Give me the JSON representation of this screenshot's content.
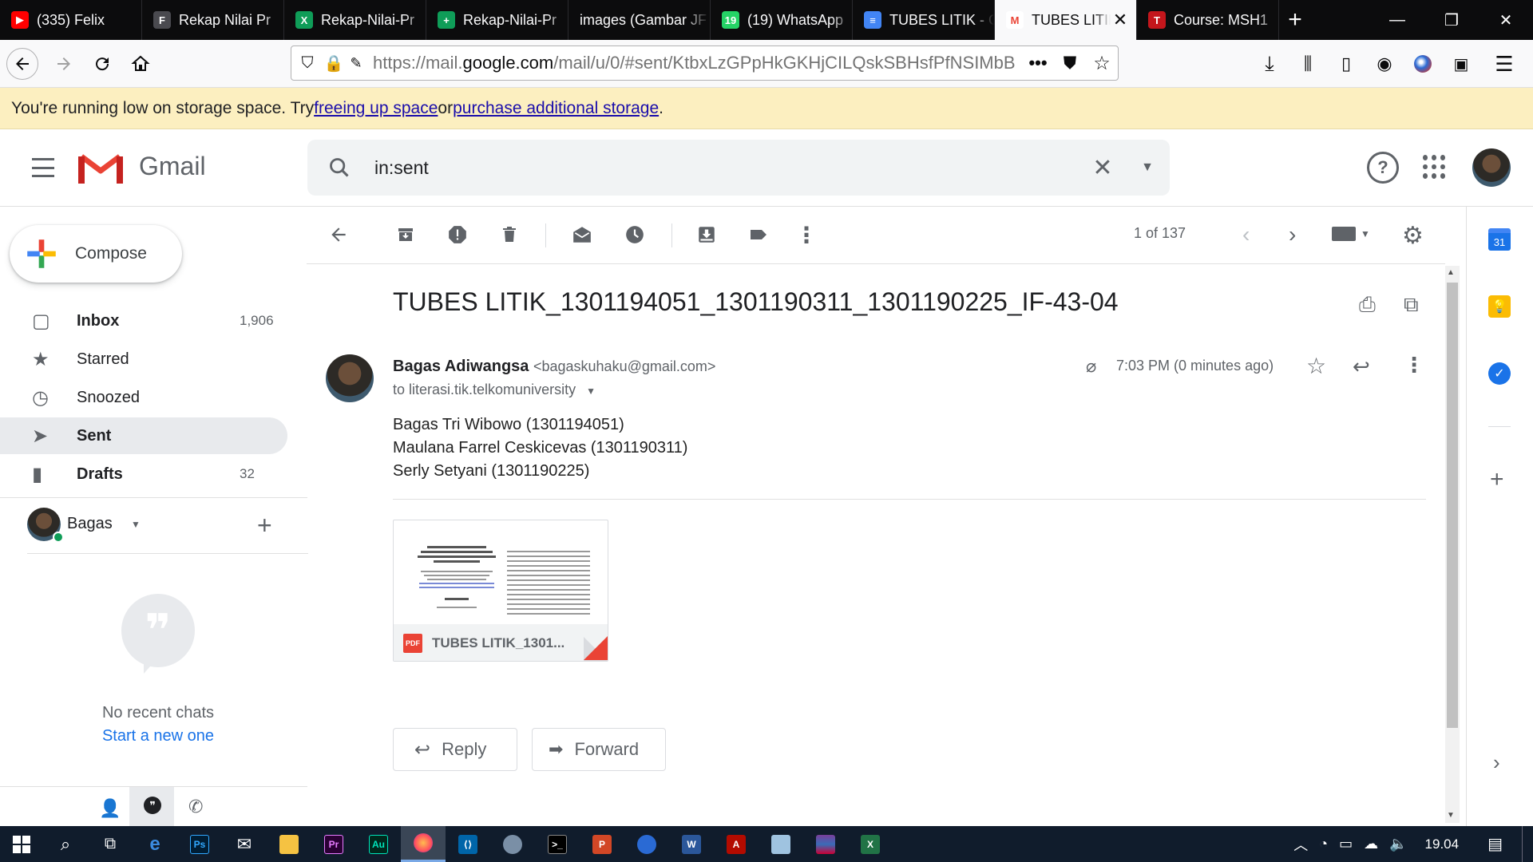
{
  "browser": {
    "tabs": [
      {
        "label": "(335) Felix",
        "color": "#ff0000",
        "glyph": "▶"
      },
      {
        "label": "Rekap Nilai Pr",
        "color": "#4a4a4f",
        "glyph": "F"
      },
      {
        "label": "Rekap-Nilai-Pr",
        "color": "#0f9d58",
        "glyph": "X"
      },
      {
        "label": "Rekap-Nilai-Pr",
        "color": "#0f9d58",
        "glyph": "+"
      },
      {
        "label": "images (Gambar JF",
        "color": "",
        "glyph": ""
      },
      {
        "label": "(19) WhatsApp",
        "color": "#25d366",
        "glyph": "19"
      },
      {
        "label": "TUBES LITIK - G",
        "color": "#4285f4",
        "glyph": "≡"
      },
      {
        "label": "TUBES LITIK",
        "color": "#ffffff",
        "glyph": "M"
      },
      {
        "label": "Course: MSH1",
        "color": "#c4161c",
        "glyph": "T"
      }
    ],
    "url_prefix": "https://mail.",
    "url_domain": "google.com",
    "url_path": "/mail/u/0/#sent/KtbxLzGPpHkGKHjCILQskSBHsfPfNSIMbB"
  },
  "banner": {
    "text_before": "You're running low on storage space. Try ",
    "link1": "freeing up space",
    "text_middle": " or ",
    "link2": "purchase additional storage",
    "text_after": "."
  },
  "gmail": {
    "logo_text": "Gmail",
    "search_value": "in:sent",
    "compose_label": "Compose",
    "nav": [
      {
        "label": "Inbox",
        "count": "1,906",
        "icon": "inbox-icon"
      },
      {
        "label": "Starred",
        "count": "",
        "icon": "star-icon"
      },
      {
        "label": "Snoozed",
        "count": "",
        "icon": "clock-icon"
      },
      {
        "label": "Sent",
        "count": "",
        "icon": "send-icon"
      },
      {
        "label": "Drafts",
        "count": "32",
        "icon": "draft-icon"
      }
    ],
    "chat_user": "Bagas",
    "no_chats": "No recent chats",
    "start_new": "Start a new one",
    "pagination": "1 of 137"
  },
  "email": {
    "subject": "TUBES LITIK_1301194051_1301190311_1301190225_IF-43-04",
    "sender_name": "Bagas Adiwangsa",
    "sender_email": "<bagaskuhaku@gmail.com>",
    "recipient": "to literasi.tik.telkomuniversity",
    "time": "7:03 PM (0 minutes ago)",
    "body": [
      "Bagas Tri Wibowo (1301194051)",
      "Maulana Farrel Ceskicevas (1301190311)",
      "Serly Setyani (1301190225)"
    ],
    "attachment_name": "TUBES LITIK_1301...",
    "attachment_badge": "PDF",
    "reply_label": "Reply",
    "forward_label": "Forward"
  },
  "taskbar": {
    "time": "19.04"
  }
}
